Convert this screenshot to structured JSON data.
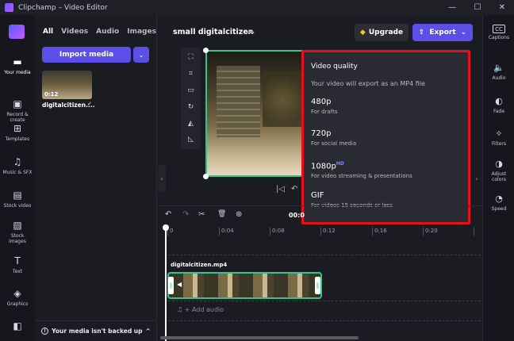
{
  "window": {
    "title": "Clipchamp – Video Editor",
    "minimize_glyph": "—",
    "maximize_glyph": "☐",
    "close_glyph": "✕"
  },
  "left_nav": {
    "items": [
      {
        "label": "Your media",
        "icon": "folder-icon",
        "glyph": "▬"
      },
      {
        "label": "Record & create",
        "icon": "camera-icon",
        "glyph": "▣"
      },
      {
        "label": "Templates",
        "icon": "templates-icon",
        "glyph": "⊞"
      },
      {
        "label": "Music & SFX",
        "icon": "music-icon",
        "glyph": "♫"
      },
      {
        "label": "Stock video",
        "icon": "stock-video-icon",
        "glyph": "▤"
      },
      {
        "label": "Stock images",
        "icon": "stock-images-icon",
        "glyph": "▨"
      },
      {
        "label": "Text",
        "icon": "text-icon",
        "glyph": "T"
      },
      {
        "label": "Graphics",
        "icon": "graphics-icon",
        "glyph": "◈"
      },
      {
        "label": "",
        "icon": "brand-kit-icon",
        "glyph": "◧"
      }
    ]
  },
  "media_panel": {
    "tabs": [
      "All",
      "Videos",
      "Audio",
      "Images"
    ],
    "import_label": "Import media",
    "import_dropdown_glyph": "⌄",
    "media_items": [
      {
        "name": "digitalcitizen....",
        "duration": "0:12",
        "check": "✓"
      }
    ],
    "backup_text": "Your media isn't backed up",
    "backup_icon_glyph": "!",
    "backup_chevron": "^"
  },
  "header": {
    "project_title": "small digitalcitizen",
    "cloud_glyph": "☁",
    "upgrade_label": "Upgrade",
    "upgrade_glyph": "◆",
    "export_label": "Export",
    "export_glyph": "⇪",
    "export_chevron": "⌄"
  },
  "preview_tools": {
    "glyphs": [
      "⛶",
      "⌗",
      "▭",
      "↻",
      "◭",
      "◺"
    ]
  },
  "player": {
    "skip_back_glyph": "|◁",
    "rewind_glyph": "↶"
  },
  "export_popup": {
    "heading": "Video quality",
    "subtitle": "Your video will export as an MP4 file",
    "options": [
      {
        "name": "480p",
        "badge": "",
        "desc": "For drafts"
      },
      {
        "name": "720p",
        "badge": "",
        "desc": "For social media"
      },
      {
        "name": "1080p",
        "badge": "HD",
        "desc": "For video streaming & presentations"
      },
      {
        "name": "GIF",
        "badge": "",
        "desc": "For videos 15 seconds or less"
      }
    ]
  },
  "right_panel": {
    "items": [
      {
        "label": "Captions",
        "icon": "captions-icon",
        "glyph": "CC"
      },
      {
        "label": "Audio",
        "icon": "audio-icon",
        "glyph": "🔈"
      },
      {
        "label": "Fade",
        "icon": "fade-icon",
        "glyph": "◐"
      },
      {
        "label": "Filters",
        "icon": "filters-icon",
        "glyph": "✧"
      },
      {
        "label": "Adjust colors",
        "icon": "adjust-colors-icon",
        "glyph": "◑"
      },
      {
        "label": "Speed",
        "icon": "speed-icon",
        "glyph": "◔"
      }
    ]
  },
  "timeline": {
    "undo_glyph": "↶",
    "redo_glyph": "↷",
    "split_glyph": "✂",
    "delete_glyph": "🗑",
    "add_glyph": "⊕",
    "time_readout": "00:0",
    "ticks": [
      "0",
      "0:04",
      "0:08",
      "0:12",
      "0:16",
      "0:20"
    ],
    "clip_name": "digitalcitizen.mp4",
    "add_audio_label": "Add audio",
    "add_audio_glyph": "♫ +"
  },
  "collapse_glyphs": {
    "left": "‹",
    "right": "›"
  }
}
